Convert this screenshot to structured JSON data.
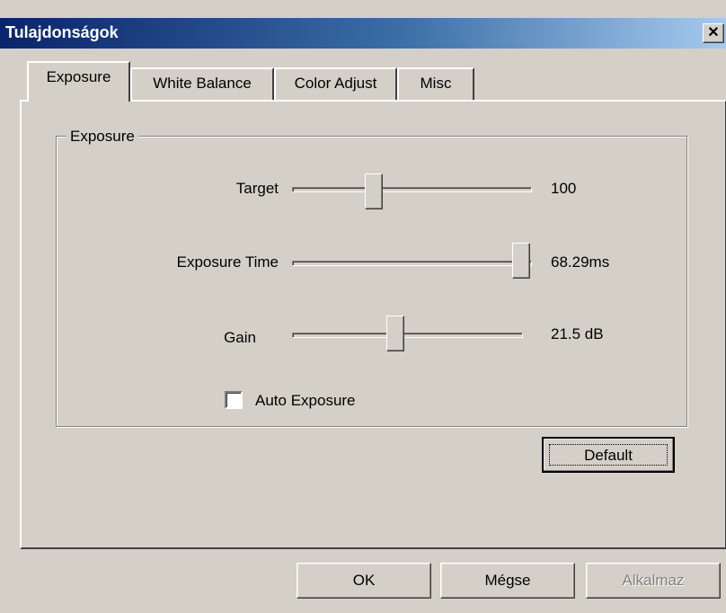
{
  "window": {
    "title": "Tulajdonságok",
    "close_glyph": "✕"
  },
  "tabs": [
    {
      "label": "Exposure",
      "active": true
    },
    {
      "label": "White Balance",
      "active": false
    },
    {
      "label": "Color Adjust",
      "active": false
    },
    {
      "label": "Misc",
      "active": false
    }
  ],
  "group": {
    "title": "Exposure",
    "sliders": [
      {
        "label": "Target",
        "value_text": "100",
        "position": 0.34
      },
      {
        "label": "Exposure Time",
        "value_text": "68.29ms",
        "position": 1.0
      },
      {
        "label": "Gain",
        "value_text": "21.5 dB",
        "position": 0.44
      }
    ],
    "auto_exposure": {
      "label": "Auto Exposure",
      "checked": false
    }
  },
  "buttons": {
    "default_label": "Default",
    "ok_label": "OK",
    "cancel_label": "Mégse",
    "apply_label": "Alkalmaz"
  }
}
